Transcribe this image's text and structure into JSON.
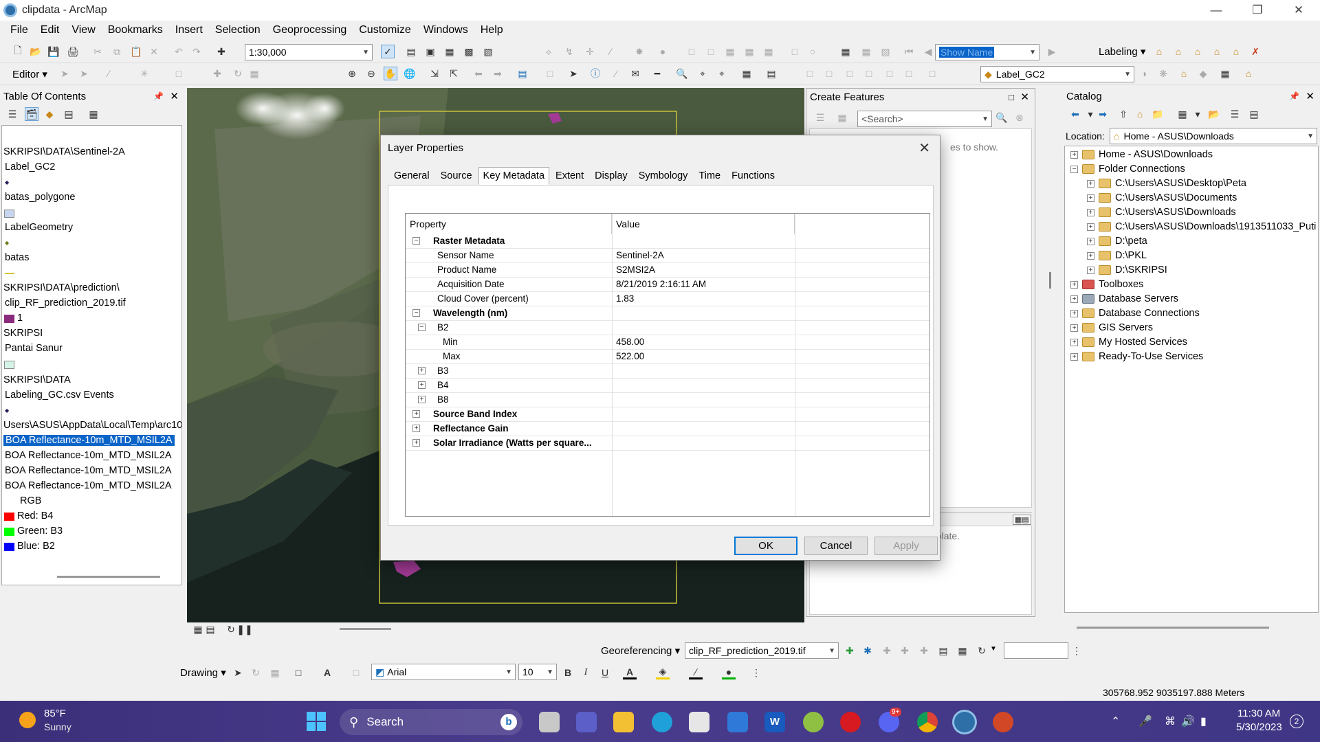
{
  "window": {
    "title": "clipdata - ArcMap"
  },
  "menu": [
    "File",
    "Edit",
    "View",
    "Bookmarks",
    "Insert",
    "Selection",
    "Geoprocessing",
    "Customize",
    "Windows",
    "Help"
  ],
  "toolbar": {
    "scale": "1:30,000",
    "show_name": "Show Name",
    "labeling": "Labeling",
    "editor": "Editor",
    "label_layer": "Label_GC2"
  },
  "toc": {
    "title": "Table Of Contents",
    "rows": [
      {
        "text": "SKRIPSI\\DATA\\Sentinel-2A"
      },
      {
        "text": "Label_GC2"
      },
      {
        "text": "batas_polygone"
      },
      {
        "text": "LabelGeometry"
      },
      {
        "text": "batas"
      },
      {
        "text": "SKRIPSI\\DATA\\prediction\\"
      },
      {
        "text": "clip_RF_prediction_2019.tif"
      },
      {
        "text": "1"
      },
      {
        "text": "SKRIPSI"
      },
      {
        "text": "Pantai Sanur"
      },
      {
        "text": "SKRIPSI\\DATA"
      },
      {
        "text": "Labeling_GC.csv Events"
      },
      {
        "text": "Users\\ASUS\\AppData\\Local\\Temp\\arc10"
      },
      {
        "text": "BOA Reflectance-10m_MTD_MSIL2A"
      },
      {
        "text": "BOA Reflectance-10m_MTD_MSIL2A"
      },
      {
        "text": "BOA Reflectance-10m_MTD_MSIL2A"
      },
      {
        "text": "BOA Reflectance-10m_MTD_MSIL2A"
      },
      {
        "text": "RGB"
      },
      {
        "text": "Red:   B4"
      },
      {
        "text": "Green: B3"
      },
      {
        "text": "Blue:  B2"
      }
    ]
  },
  "create_features": {
    "title": "Create Features",
    "search_placeholder": "<Search>",
    "hint": "es to show.",
    "select_template": "Select a template."
  },
  "catalog": {
    "title": "Catalog",
    "location_label": "Location:",
    "location_value": "Home - ASUS\\Downloads",
    "tree": [
      {
        "label": "Home - ASUS\\Downloads",
        "level": 0,
        "pm": "+"
      },
      {
        "label": "Folder Connections",
        "level": 0,
        "pm": "−"
      },
      {
        "label": "C:\\Users\\ASUS\\Desktop\\Peta",
        "level": 1,
        "pm": "+"
      },
      {
        "label": "C:\\Users\\ASUS\\Documents",
        "level": 1,
        "pm": "+"
      },
      {
        "label": "C:\\Users\\ASUS\\Downloads",
        "level": 1,
        "pm": "+"
      },
      {
        "label": "C:\\Users\\ASUS\\Downloads\\1913511033_Puti",
        "level": 1,
        "pm": "+"
      },
      {
        "label": "D:\\peta",
        "level": 1,
        "pm": "+"
      },
      {
        "label": "D:\\PKL",
        "level": 1,
        "pm": "+"
      },
      {
        "label": "D:\\SKRIPSI",
        "level": 1,
        "pm": "+"
      },
      {
        "label": "Toolboxes",
        "level": 0,
        "pm": "+"
      },
      {
        "label": "Database Servers",
        "level": 0,
        "pm": "+"
      },
      {
        "label": "Database Connections",
        "level": 0,
        "pm": "+"
      },
      {
        "label": "GIS Servers",
        "level": 0,
        "pm": "+"
      },
      {
        "label": "My Hosted Services",
        "level": 0,
        "pm": "+"
      },
      {
        "label": "Ready-To-Use Services",
        "level": 0,
        "pm": "+"
      }
    ]
  },
  "dialog": {
    "title": "Layer Properties",
    "tabs": [
      "General",
      "Source",
      "Key Metadata",
      "Extent",
      "Display",
      "Symbology",
      "Time",
      "Functions"
    ],
    "active_tab": "Key Metadata",
    "col_property": "Property",
    "col_value": "Value",
    "rows": [
      {
        "prop": "Raster Metadata",
        "val": "",
        "level": 0,
        "pm": "−",
        "bold": true
      },
      {
        "prop": "Sensor Name",
        "val": "Sentinel-2A",
        "level": 1
      },
      {
        "prop": "Product Name",
        "val": "S2MSI2A",
        "level": 1
      },
      {
        "prop": "Acquisition Date",
        "val": "8/21/2019 2:16:11 AM",
        "level": 1
      },
      {
        "prop": "Cloud Cover (percent)",
        "val": "1.83",
        "level": 1
      },
      {
        "prop": "Wavelength (nm)",
        "val": "",
        "level": 0,
        "pm": "−",
        "bold": true
      },
      {
        "prop": "B2",
        "val": "",
        "level": 1,
        "pm": "−"
      },
      {
        "prop": "Min",
        "val": "458.00",
        "level": 2
      },
      {
        "prop": "Max",
        "val": "522.00",
        "level": 2
      },
      {
        "prop": "B3",
        "val": "",
        "level": 1,
        "pm": "+"
      },
      {
        "prop": "B4",
        "val": "",
        "level": 1,
        "pm": "+"
      },
      {
        "prop": "B8",
        "val": "",
        "level": 1,
        "pm": "+"
      },
      {
        "prop": "Source Band Index",
        "val": "",
        "level": 0,
        "pm": "+",
        "bold": true
      },
      {
        "prop": "Reflectance Gain",
        "val": "",
        "level": 0,
        "pm": "+",
        "bold": true
      },
      {
        "prop": "Solar Irradiance (Watts per square...",
        "val": "",
        "level": 0,
        "pm": "+",
        "bold": true
      }
    ],
    "ok": "OK",
    "cancel": "Cancel",
    "apply": "Apply"
  },
  "bottom_toolbars": {
    "georeferencing": "Georeferencing",
    "geo_layer": "clip_RF_prediction_2019.tif",
    "drawing": "Drawing",
    "font": "Arial",
    "font_size": "10"
  },
  "status": {
    "coords": "305768.952  9035197.888 Meters"
  },
  "taskbar": {
    "weather_temp": "85°F",
    "weather_desc": "Sunny",
    "search": "Search",
    "time": "11:30 AM",
    "date": "5/30/2023",
    "notif_count": "2",
    "discord_badge": "9+"
  },
  "colors": {
    "accent": "#0078d7",
    "selection": "#0a64c8",
    "taskbar": "#3f3685"
  }
}
